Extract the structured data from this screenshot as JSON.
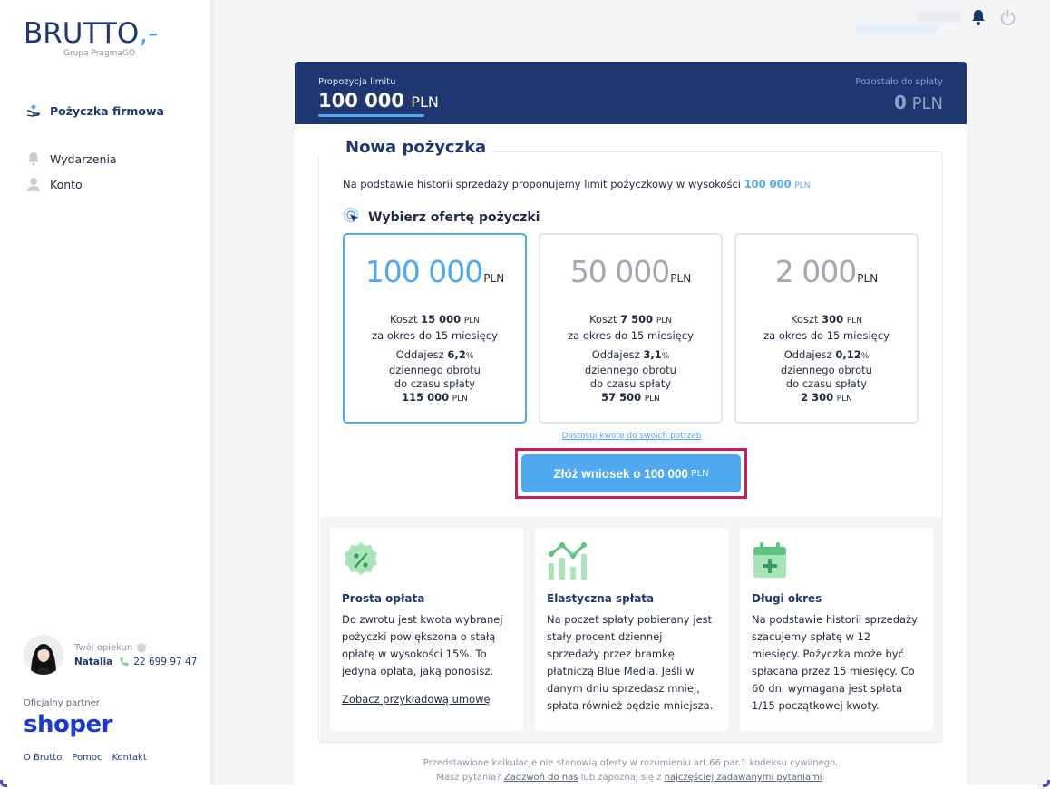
{
  "logo": {
    "brand": "BRUTTO",
    "dash": ",-",
    "sub": "Grupa PragmaGO"
  },
  "nav": {
    "items": [
      {
        "label": "Pożyczka firmowa",
        "icon": "hand-coin-icon"
      },
      {
        "label": "Wydarzenia",
        "icon": "bell-icon"
      },
      {
        "label": "Konto",
        "icon": "user-icon"
      }
    ]
  },
  "guardian": {
    "label": "Twój opiekun",
    "name": "Natalia",
    "phone": "22 699 97 47"
  },
  "partner": {
    "label": "Oficjalny partner",
    "brand": "shoper"
  },
  "footer_links": [
    "O Brutto",
    "Pomoc",
    "Kontakt"
  ],
  "header": {
    "limit_label": "Propozycja limitu",
    "limit_value": "100 000",
    "limit_unit": "PLN",
    "remaining_label": "Pozostało do spłaty",
    "remaining_value": "0",
    "remaining_unit": "PLN"
  },
  "main": {
    "title": "Nowa pożyczka",
    "desc_prefix": "Na podstawie historii sprzedaży proponujemy limit pożyczkowy w wysokości",
    "desc_amount": "100 000",
    "desc_unit": "PLN",
    "choose_label": "Wybierz ofertę pożyczki",
    "offers": [
      {
        "amount": "100 000",
        "unit": "PLN",
        "cost_label": "Koszt",
        "cost": "15 000",
        "cost_unit": "PLN",
        "period": "za okres do 15 miesięcy",
        "pay_label": "Oddajesz",
        "percent": "6,2",
        "percent_sign": "%",
        "turnover": "dziennego obrotu",
        "until": "do czasu spłaty",
        "total": "115 000",
        "total_unit": "PLN"
      },
      {
        "amount": "50 000",
        "unit": "PLN",
        "cost_label": "Koszt",
        "cost": "7 500",
        "cost_unit": "PLN",
        "period": "za okres do 15 miesięcy",
        "pay_label": "Oddajesz",
        "percent": "3,1",
        "percent_sign": "%",
        "turnover": "dziennego obrotu",
        "until": "do czasu spłaty",
        "total": "57 500",
        "total_unit": "PLN"
      },
      {
        "amount": "2 000",
        "unit": "PLN",
        "cost_label": "Koszt",
        "cost": "300",
        "cost_unit": "PLN",
        "period": "za okres do 15 miesięcy",
        "pay_label": "Oddajesz",
        "percent": "0,12",
        "percent_sign": "%",
        "turnover": "dziennego obrotu",
        "until": "do czasu spłaty",
        "total": "2 300",
        "total_unit": "PLN"
      }
    ],
    "adjust_link": "Dostosuj kwotę do swoich potrzeb",
    "cta_label": "Złóż wniosek o 100 000",
    "cta_unit": "PLN"
  },
  "info": [
    {
      "icon": "percent-badge-icon",
      "title": "Prosta opłata",
      "text": "Do zwrotu jest kwota wybranej pożyczki powiększona o stałą opłatę w wysokości 15%. To jedyna opłata, jaką ponosisz.",
      "link": "Zobacz przykładową umowę"
    },
    {
      "icon": "growth-chart-icon",
      "title": "Elastyczna spłata",
      "text": "Na poczet spłaty pobierany jest stały procent dziennej sprzedaży przez bramkę płatniczą Blue Media. Jeśli w danym dniu sprzedasz mniej, spłata również będzie mniejsza."
    },
    {
      "icon": "calendar-plus-icon",
      "title": "Długi okres",
      "text": "Na podstawie historii sprzedaży szacujemy spłatę w 12 miesięcy. Pożyczka może być spłacana przez 15 miesięcy. Co 60 dni wymagana jest spłata 1/15 początkowej kwoty."
    }
  ],
  "disclaimer": {
    "line1": "Przedstawione kalkulacje nie stanowią oferty w rozumieniu art.66 par.1 kodeksu cywilnego.",
    "line2_a": "Masz pytania?",
    "line2_link1": "Zadzwoń do nas",
    "line2_b": "lub zapoznaj się z",
    "line2_link2": "najczęściej zadawanymi pytaniami",
    "line2_end": "."
  },
  "colors": {
    "navy": "#1e3771",
    "accent": "#4fa8f0",
    "highlight": "#cc1c5c",
    "green": "#7ed69a",
    "shoper": "#1a3ad8"
  }
}
